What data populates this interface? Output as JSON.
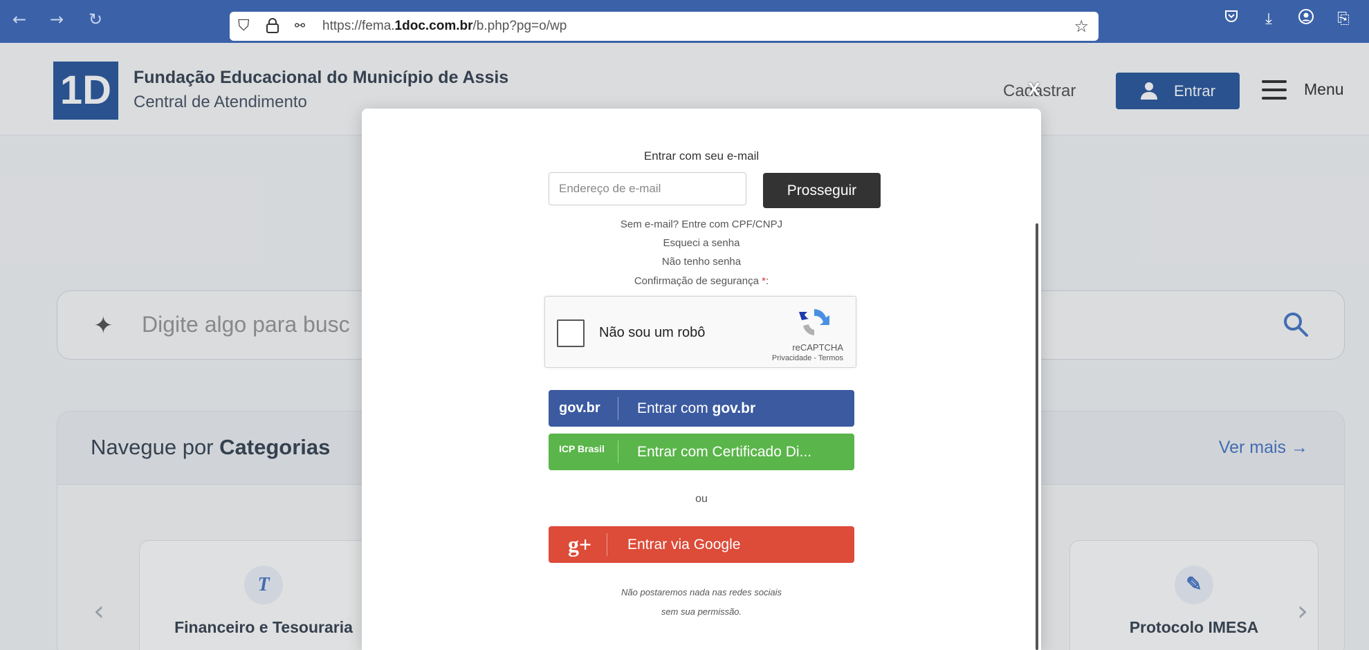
{
  "browser": {
    "url_prefix": "https://fema.",
    "url_domain": "1doc.com.br",
    "url_path": "/b.php?pg=o/wp",
    "icons": [
      "back-icon",
      "forward-icon",
      "reload-icon",
      "shield-icon",
      "lock-icon",
      "permissions-icon",
      "star-icon",
      "pocket-icon",
      "download-icon",
      "account-icon",
      "extensions-icon"
    ]
  },
  "header": {
    "logo_text": "1D",
    "org_name": "Fundação Educacional do Município de Assis",
    "org_subtitle": "Central de Atendimento",
    "cadastrar_label": "Cadastrar",
    "entrar_label": "Entrar",
    "menu_label": "Menu"
  },
  "search": {
    "placeholder": "Digite algo para busc"
  },
  "categories": {
    "title_prefix": "Navegue por ",
    "title_bold": "Categorias",
    "see_more": "Ver mais →",
    "items": [
      {
        "label": "Financeiro e Tesouraria",
        "icon": "T"
      },
      {
        "label": "Protocolo IMESA",
        "icon": "✎"
      }
    ],
    "prev_arrow": "‹",
    "next_arrow": "›"
  },
  "modal": {
    "close_label": "X",
    "heading": "Entrar com seu e-mail",
    "email_placeholder": "Endereço de e-mail",
    "proceed_label": "Prosseguir",
    "links": {
      "cpf": "Sem e-mail? Entre com CPF/CNPJ",
      "forgot": "Esqueci a senha",
      "no_password": "Não tenho senha"
    },
    "security_label": "Confirmação de segurança ",
    "security_required": "*",
    "security_suffix": ":",
    "captcha": {
      "label": "Não sou um robô",
      "brand": "reCAPTCHA",
      "terms": "Privacidade - Termos"
    },
    "govbr": {
      "logo": "gov.br",
      "label_prefix": "Entrar com ",
      "label_bold": "gov.br"
    },
    "icp": {
      "logo": "ICP Brasil",
      "label": "Entrar com Certificado Di..."
    },
    "or_label": "ou",
    "google": {
      "logo": "g+",
      "label": "Entrar via Google"
    },
    "disclaimer_line1": "Não postaremos nada nas redes sociais",
    "disclaimer_line2": "sem sua permissão."
  },
  "colors": {
    "browser_bar": "#3b62a8",
    "brand_blue": "#2c5aa0",
    "govbr": "#3b5aa0",
    "icp": "#5ab54a",
    "google": "#dd4b39",
    "proceed": "#333333"
  }
}
